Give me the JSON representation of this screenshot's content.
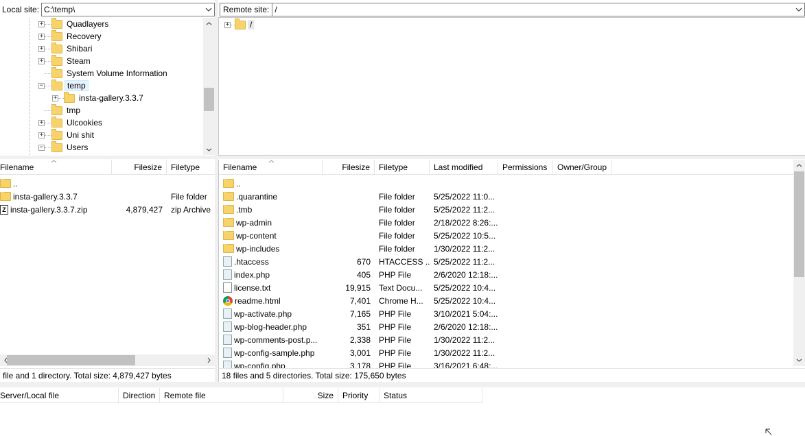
{
  "local_site": {
    "label": "Local site:",
    "path": "C:\\temp\\"
  },
  "remote_site": {
    "label": "Remote site:",
    "path": "/"
  },
  "local_tree": [
    {
      "name": "Quadlayers",
      "expander": "+"
    },
    {
      "name": "Recovery",
      "expander": "+"
    },
    {
      "name": "Shibari",
      "expander": "+"
    },
    {
      "name": "Steam",
      "expander": "+"
    },
    {
      "name": "System Volume Information",
      "expander": ""
    },
    {
      "name": "temp",
      "expander": "−"
    },
    {
      "name": "insta-gallery.3.3.7",
      "expander": "+"
    },
    {
      "name": "tmp",
      "expander": ""
    },
    {
      "name": "Ulcookies",
      "expander": "+"
    },
    {
      "name": "Uni shit",
      "expander": "+"
    },
    {
      "name": "Users",
      "expander": "−"
    }
  ],
  "remote_tree": {
    "root": "/",
    "expander": "+"
  },
  "local_columns": {
    "filename": "Filename",
    "filesize": "Filesize",
    "filetype": "Filetype"
  },
  "local_files": [
    {
      "name": "..",
      "size": "",
      "type": ""
    },
    {
      "name": "insta-gallery.3.3.7",
      "size": "",
      "type": "File folder"
    },
    {
      "name": "insta-gallery.3.3.7.zip",
      "size": "4,879,427",
      "type": "zip Archive"
    }
  ],
  "remote_columns": {
    "filename": "Filename",
    "filesize": "Filesize",
    "filetype": "Filetype",
    "modified": "Last modified",
    "permissions": "Permissions",
    "owner": "Owner/Group"
  },
  "remote_files": [
    {
      "name": "..",
      "size": "",
      "type": "",
      "modified": "",
      "icon": "folder"
    },
    {
      "name": ".quarantine",
      "size": "",
      "type": "File folder",
      "modified": "5/25/2022 11:0...",
      "icon": "folder"
    },
    {
      "name": ".tmb",
      "size": "",
      "type": "File folder",
      "modified": "5/25/2022 11:2...",
      "icon": "folder"
    },
    {
      "name": "wp-admin",
      "size": "",
      "type": "File folder",
      "modified": "2/18/2022 8:26:...",
      "icon": "folder"
    },
    {
      "name": "wp-content",
      "size": "",
      "type": "File folder",
      "modified": "5/25/2022 10:5...",
      "icon": "folder"
    },
    {
      "name": "wp-includes",
      "size": "",
      "type": "File folder",
      "modified": "1/30/2022 11:2...",
      "icon": "folder"
    },
    {
      "name": ".htaccess",
      "size": "670",
      "type": "HTACCESS ...",
      "modified": "5/25/2022 11:2...",
      "icon": "file"
    },
    {
      "name": "index.php",
      "size": "405",
      "type": "PHP File",
      "modified": "2/6/2020 12:18:...",
      "icon": "file"
    },
    {
      "name": "license.txt",
      "size": "19,915",
      "type": "Text Docu...",
      "modified": "5/25/2022 10:4...",
      "icon": "txt"
    },
    {
      "name": "readme.html",
      "size": "7,401",
      "type": "Chrome H...",
      "modified": "5/25/2022 10:4...",
      "icon": "chrome"
    },
    {
      "name": "wp-activate.php",
      "size": "7,165",
      "type": "PHP File",
      "modified": "3/10/2021 5:04:...",
      "icon": "file"
    },
    {
      "name": "wp-blog-header.php",
      "size": "351",
      "type": "PHP File",
      "modified": "2/6/2020 12:18:...",
      "icon": "file"
    },
    {
      "name": "wp-comments-post.p...",
      "size": "2,338",
      "type": "PHP File",
      "modified": "1/30/2022 11:2...",
      "icon": "file"
    },
    {
      "name": "wp-config-sample.php",
      "size": "3,001",
      "type": "PHP File",
      "modified": "1/30/2022 11:2...",
      "icon": "file"
    },
    {
      "name": "wp-config.php",
      "size": "3,178",
      "type": "PHP File",
      "modified": "3/16/2021 6:48:...",
      "icon": "file"
    }
  ],
  "local_status": "file and 1 directory. Total size: 4,879,427 bytes",
  "remote_status": "18 files and 5 directories. Total size: 175,650 bytes",
  "queue_columns": {
    "server_local": "Server/Local file",
    "direction": "Direction",
    "remote_file": "Remote file",
    "size": "Size",
    "priority": "Priority",
    "status": "Status"
  }
}
